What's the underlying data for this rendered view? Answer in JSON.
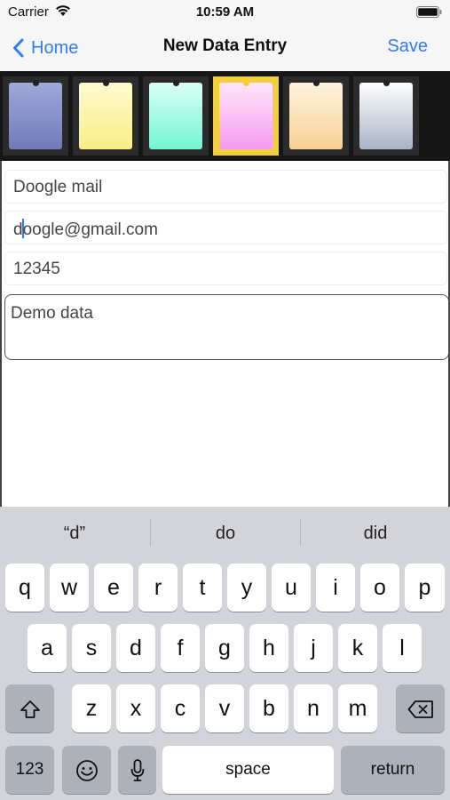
{
  "status": {
    "carrier": "Carrier",
    "time": "10:59 AM"
  },
  "nav": {
    "back_label": "Home",
    "title": "New Data Entry",
    "save_label": "Save"
  },
  "swatches": [
    {
      "top": "#a1a8da",
      "bottom": "#6f7ab8",
      "selected": false
    },
    {
      "top": "#fffbd0",
      "bottom": "#f9ed86",
      "selected": false
    },
    {
      "top": "#dbfff6",
      "bottom": "#72f5d3",
      "selected": false
    },
    {
      "top": "#ffe6fb",
      "bottom": "#f59aef",
      "selected": true
    },
    {
      "top": "#fff3df",
      "bottom": "#f8d193",
      "selected": false
    },
    {
      "top": "#ffffff",
      "bottom": "#a9b4c6",
      "selected": false
    }
  ],
  "form": {
    "title_value": "Doogle mail",
    "email_prefix": "d",
    "email_suffix": "oogle@gmail.com",
    "code_value": "12345",
    "notes_value": "Demo data"
  },
  "keyboard": {
    "suggestions": [
      "“d”",
      "do",
      "did"
    ],
    "row1": [
      "q",
      "w",
      "e",
      "r",
      "t",
      "y",
      "u",
      "i",
      "o",
      "p"
    ],
    "row2": [
      "a",
      "s",
      "d",
      "f",
      "g",
      "h",
      "j",
      "k",
      "l"
    ],
    "row3": [
      "z",
      "x",
      "c",
      "v",
      "b",
      "n",
      "m"
    ],
    "numbers_label": "123",
    "space_label": "space",
    "return_label": "return"
  },
  "colors": {
    "accent": "#2f7cf6",
    "selected_border": "#f1cf3f"
  }
}
